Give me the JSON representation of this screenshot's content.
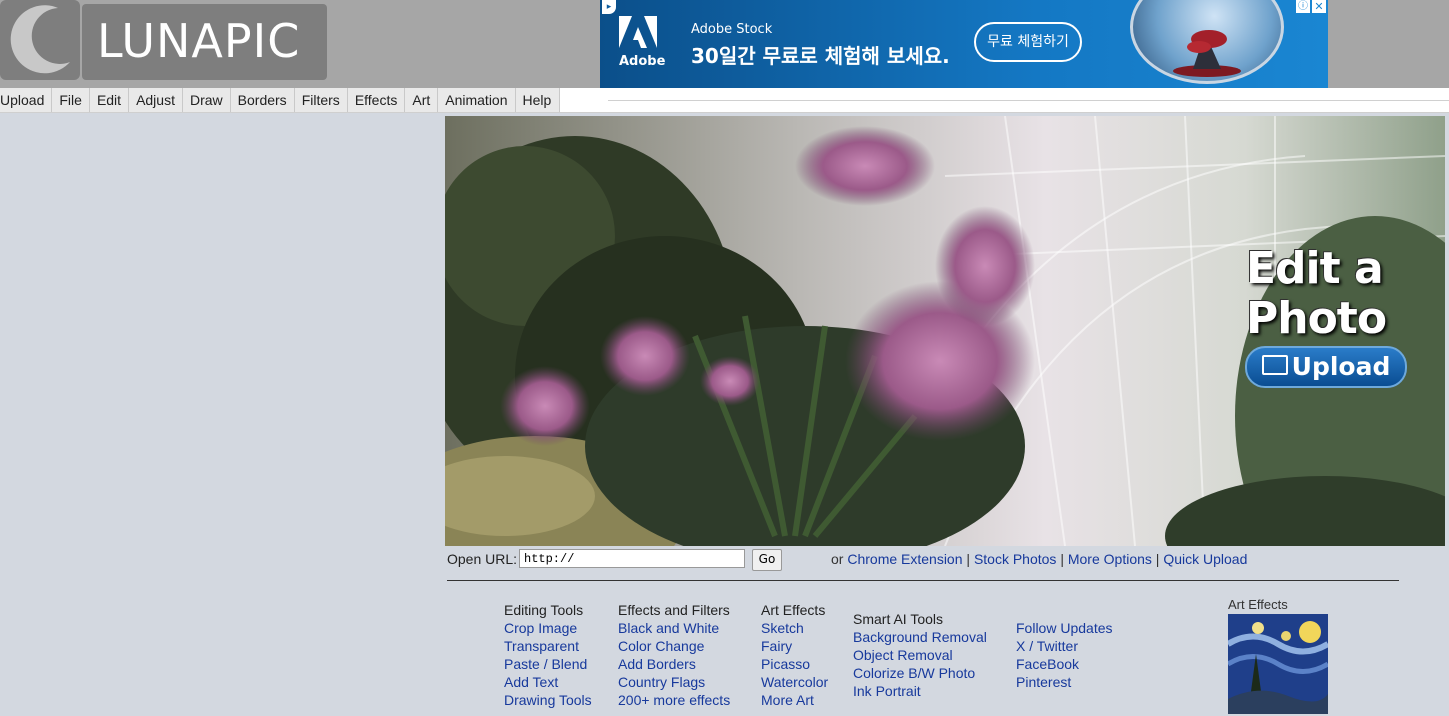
{
  "logo": {
    "text": "LUNAPIC"
  },
  "ad": {
    "brand_logo_text": "Adobe",
    "brand": "Adobe Stock",
    "headline": "30일간 무료로 체험해 보세요.",
    "cta": "무료 체험하기",
    "info_icon": "ⓘ",
    "close_icon": "✕"
  },
  "menu": {
    "items": [
      {
        "label": "Upload"
      },
      {
        "label": "File"
      },
      {
        "label": "Edit"
      },
      {
        "label": "Adjust"
      },
      {
        "label": "Draw"
      },
      {
        "label": "Borders"
      },
      {
        "label": "Filters"
      },
      {
        "label": "Effects"
      },
      {
        "label": "Art"
      },
      {
        "label": "Animation"
      },
      {
        "label": "Help"
      }
    ]
  },
  "hero": {
    "title_line1": "Edit a",
    "title_line2": "Photo",
    "upload_label": "Upload"
  },
  "open_url": {
    "label": "Open URL:",
    "value": "http://",
    "go_label": "Go"
  },
  "links": {
    "prefix": "or",
    "items": [
      {
        "label": "Chrome Extension"
      },
      {
        "label": "Stock Photos"
      },
      {
        "label": "More Options"
      },
      {
        "label": "Quick Upload"
      }
    ],
    "separator": "|"
  },
  "columns": [
    {
      "heading": "Editing Tools",
      "links": [
        "Crop Image",
        "Transparent",
        "Paste / Blend",
        "Add Text",
        "Drawing Tools"
      ]
    },
    {
      "heading": "Effects and Filters",
      "links": [
        "Black and White",
        "Color Change",
        "Add Borders",
        "Country Flags",
        "200+ more effects"
      ]
    },
    {
      "heading": "Art Effects",
      "links": [
        "Sketch",
        "Fairy",
        "Picasso",
        "Watercolor",
        "More Art"
      ]
    },
    {
      "heading": "Smart AI Tools",
      "links": [
        "Background Removal",
        "Object Removal",
        "Colorize B/W Photo",
        "Ink Portrait"
      ]
    },
    {
      "heading": "",
      "links": [
        "Follow Updates",
        "X / Twitter",
        "FaceBook",
        "Pinterest"
      ]
    }
  ],
  "art_effects": {
    "label": "Art Effects"
  },
  "colors": {
    "page_bg": "#d3d8e0",
    "link": "#17399c",
    "topbar": "#a6a6a6",
    "ad_blue": "#1478c4"
  }
}
